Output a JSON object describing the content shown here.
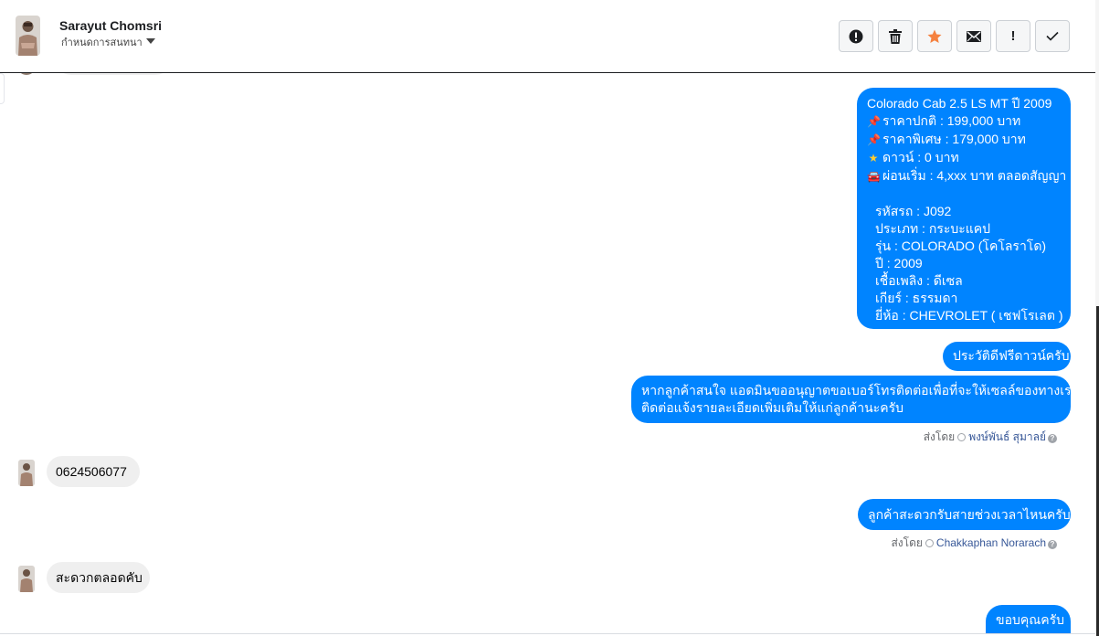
{
  "header": {
    "contact_name": "Sarayut Chomsri",
    "contact_sub": "กำหนดการสนทนา"
  },
  "toolbar": {
    "buttons": [
      {
        "icon": "alert-circle-icon",
        "label": "Mark as spam"
      },
      {
        "icon": "trash-icon",
        "label": "Delete"
      },
      {
        "icon": "star-icon",
        "label": "Star",
        "color": "#f5813f"
      },
      {
        "icon": "mail-icon",
        "label": "Mark as unread"
      },
      {
        "icon": "exclamation-icon",
        "label": "!"
      },
      {
        "icon": "checkmark-icon",
        "label": "Done"
      }
    ]
  },
  "messages": {
    "car_info": {
      "title": "Colorado Cab 2.5 LS MT ปี 2009",
      "normal_price": "ราคาปกติ : 199,000 บาท",
      "special_price": "ราคาพิเศษ : 179,000 บาท",
      "down": "ดาวน์ : 0 บาท",
      "installment": "ผ่อนเริ่ม : 4,xxx บาท ตลอดสัญญา",
      "code": "รหัสรถ : J092",
      "type": "ประเภท : กระบะแคป",
      "model": "รุ่น : COLORADO (โคโลราโด)",
      "year": "ปี : 2009",
      "fuel": "เชื้อเพลิง : ดีเซล",
      "gear": "เกียร์ : ธรรมดา",
      "brand": "ยี่ห้อ : CHEVROLET ( เชฟโรเลต )"
    },
    "free_down": "ประวัติดีฟรีดาวน์ครับ",
    "ask_phone_line1": "หากลูกค้าสนใจ แอดมินขออนุญาตขอเบอร์โทรติดต่อเพื่อที่จะให้เซลล์ของทางเรา",
    "ask_phone_line2": "ติดต่อแจ้งรายละเอียดเพิ่มเติมให้แก่ลูกค้านะครับ",
    "sent_by_1_prefix": "ส่งโดย",
    "sent_by_1_agent": "พงษ์พันธ์ สุมาลย์",
    "customer_phone": "0624506077",
    "ask_time": "ลูกค้าสะดวกรับสายช่วงเวลาไหนครับ",
    "sent_by_2_prefix": "ส่งโดย",
    "sent_by_2_agent": "Chakkaphan Norarach",
    "customer_reply": "สะดวกตลอดคับ",
    "thanks": "ขอบคุณครับ"
  },
  "colors": {
    "outgoing_bubble": "#0084ff",
    "incoming_bubble": "#efefef",
    "star_button": "#f5813f"
  }
}
